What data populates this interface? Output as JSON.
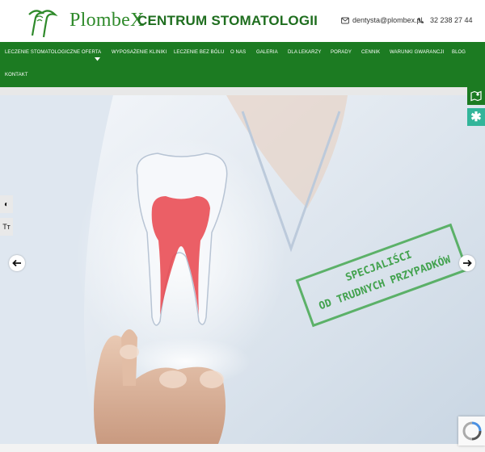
{
  "header": {
    "logo_text": "PlombeX",
    "title": "CENTRUM STOMATOLOGII",
    "email": "dentysta@plombex.pl",
    "phone": "32 238 27 44"
  },
  "nav": {
    "items": [
      {
        "label": "LECZENIE STOMATOLOGICZNE OFERTA",
        "has_dropdown": true
      },
      {
        "label": "WYPOSAŻENIE KLINIKI"
      },
      {
        "label": "LECZENIE BEZ BÓLU"
      },
      {
        "label": "O NAS"
      },
      {
        "label": "GALERIA"
      },
      {
        "label": "DLA LEKARZY"
      },
      {
        "label": "PORADY"
      },
      {
        "label": "CENNIK"
      },
      {
        "label": "WARUNKI GWARANCJI"
      },
      {
        "label": "BLOG"
      },
      {
        "label": "KONTAKT"
      }
    ]
  },
  "hero": {
    "stamp_line1": "SPECJALIŚCI",
    "stamp_line2": "OD TRUDNYCH PRZYPADKÓW"
  },
  "colors": {
    "brand_green": "#1c7b22",
    "logo_green": "#2f8a2b",
    "side_teal": "#33b59a"
  },
  "icons": {
    "email": "envelope-icon",
    "phone": "phone-icon",
    "map": "map-icon",
    "booksy": "asterisk-icon",
    "contrast": "contrast-icon",
    "text_size": "text-size-icon",
    "prev": "arrow-left-icon",
    "next": "arrow-right-icon",
    "dropdown": "caret-down-icon",
    "recaptcha": "recaptcha-icon"
  }
}
